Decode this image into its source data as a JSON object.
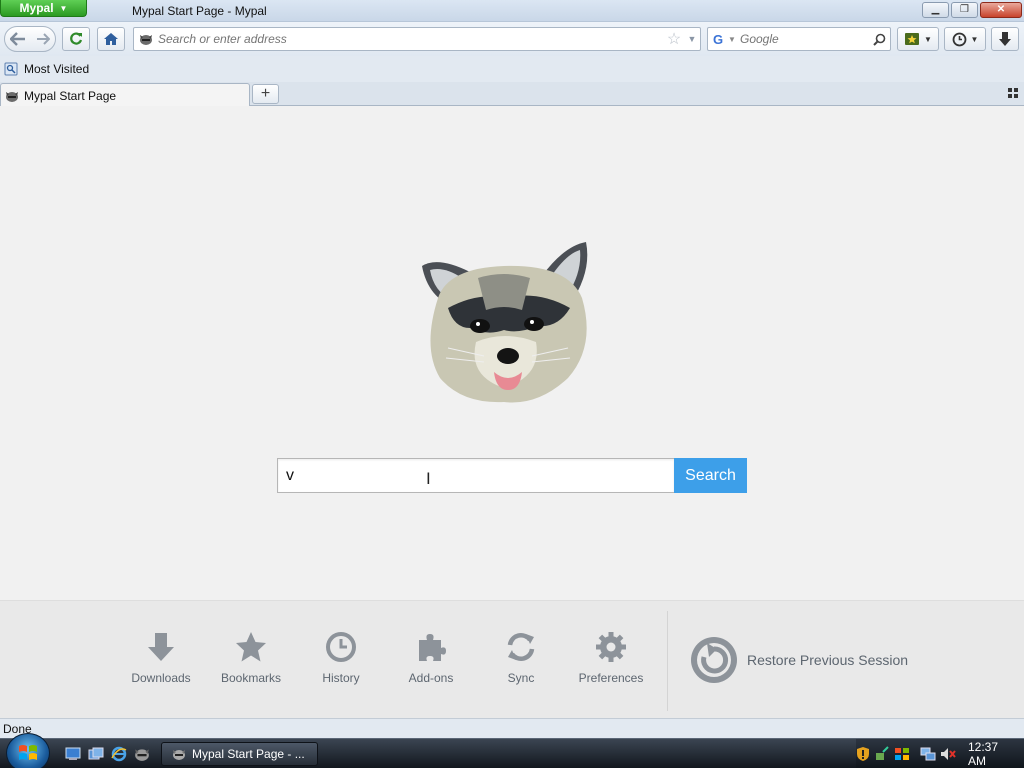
{
  "window": {
    "app_menu_label": "Mypal",
    "title": "Mypal Start Page - Mypal"
  },
  "toolbar": {
    "address_placeholder": "Search or enter address",
    "search_engine": "Google",
    "search_placeholder": "Google"
  },
  "bookmarks_bar": {
    "items": [
      {
        "label": "Most Visited",
        "icon": "bookmark-folder-icon"
      }
    ]
  },
  "tabs": [
    {
      "label": "Mypal Start Page",
      "icon": "raccoon-favicon-icon",
      "active": true
    }
  ],
  "start_page": {
    "search_value": "v",
    "search_button_label": "Search",
    "launcher": [
      {
        "label": "Downloads",
        "icon": "download-arrow-icon"
      },
      {
        "label": "Bookmarks",
        "icon": "star-icon"
      },
      {
        "label": "History",
        "icon": "clock-icon"
      },
      {
        "label": "Add-ons",
        "icon": "puzzle-piece-icon"
      },
      {
        "label": "Sync",
        "icon": "sync-arrows-icon"
      },
      {
        "label": "Preferences",
        "icon": "gear-icon"
      }
    ],
    "restore_session_label": "Restore Previous Session"
  },
  "status": {
    "text": "Done"
  },
  "taskbar": {
    "active_window_label": "Mypal Start Page - ...",
    "clock": "12:37 AM"
  },
  "colors": {
    "search_button": "#3d9fe9",
    "app_menu": "#2b9a22",
    "launcher_text": "#5d6670"
  }
}
